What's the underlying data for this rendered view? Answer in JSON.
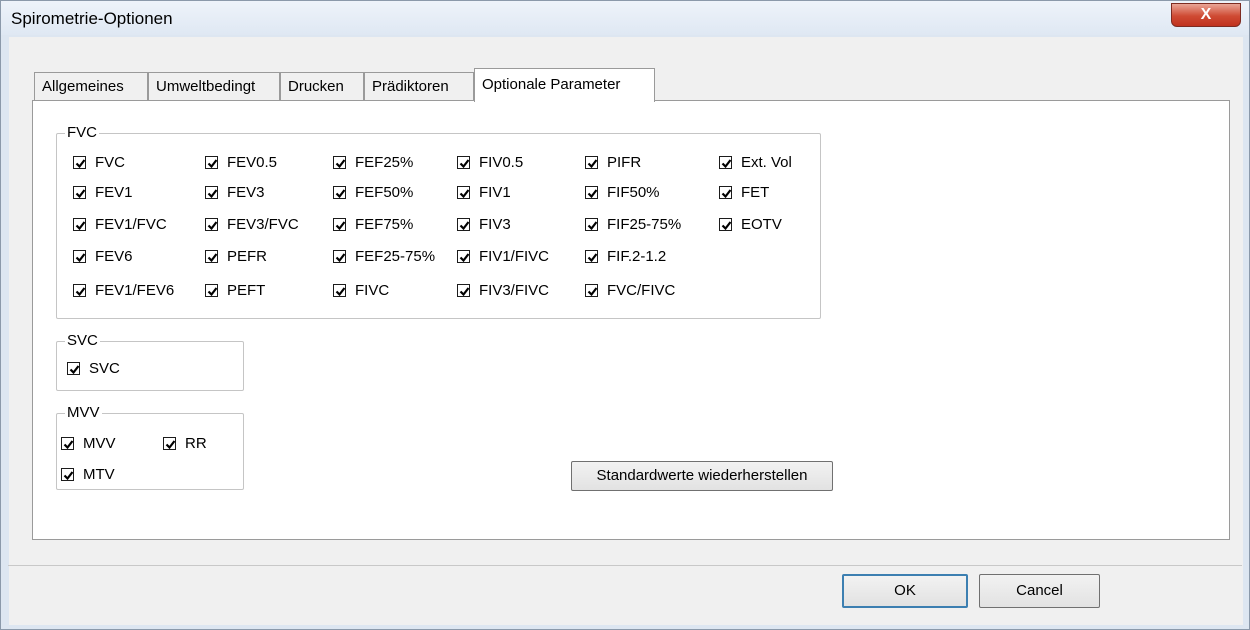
{
  "window": {
    "title": "Spirometrie-Optionen",
    "close_glyph": "X"
  },
  "tabs": [
    {
      "label": "Allgemeines",
      "active": false
    },
    {
      "label": "Umweltbedingt",
      "active": false
    },
    {
      "label": "Drucken",
      "active": false
    },
    {
      "label": "Prädiktoren",
      "active": false
    },
    {
      "label": "Optionale Parameter",
      "active": true
    }
  ],
  "groups": {
    "fvc": {
      "title": "FVC",
      "columns": [
        [
          {
            "label": "FVC",
            "checked": true
          },
          {
            "label": "FEV1",
            "checked": true
          },
          {
            "label": "FEV1/FVC",
            "checked": true
          },
          {
            "label": "FEV6",
            "checked": true
          },
          {
            "label": "FEV1/FEV6",
            "checked": true
          }
        ],
        [
          {
            "label": "FEV0.5",
            "checked": true
          },
          {
            "label": "FEV3",
            "checked": true
          },
          {
            "label": "FEV3/FVC",
            "checked": true
          },
          {
            "label": "PEFR",
            "checked": true
          },
          {
            "label": "PEFT",
            "checked": true
          }
        ],
        [
          {
            "label": "FEF25%",
            "checked": true
          },
          {
            "label": "FEF50%",
            "checked": true
          },
          {
            "label": "FEF75%",
            "checked": true
          },
          {
            "label": "FEF25-75%",
            "checked": true
          },
          {
            "label": "FIVC",
            "checked": true
          }
        ],
        [
          {
            "label": "FIV0.5",
            "checked": true
          },
          {
            "label": "FIV1",
            "checked": true
          },
          {
            "label": "FIV3",
            "checked": true
          },
          {
            "label": "FIV1/FIVC",
            "checked": true
          },
          {
            "label": "FIV3/FIVC",
            "checked": true
          }
        ],
        [
          {
            "label": "PIFR",
            "checked": true
          },
          {
            "label": "FIF50%",
            "checked": true
          },
          {
            "label": "FIF25-75%",
            "checked": true
          },
          {
            "label": "FIF.2-1.2",
            "checked": true
          },
          {
            "label": "FVC/FIVC",
            "checked": true
          }
        ],
        [
          {
            "label": "Ext. Vol",
            "checked": true
          },
          {
            "label": "FET",
            "checked": true
          },
          {
            "label": "EOTV",
            "checked": true
          }
        ]
      ]
    },
    "svc": {
      "title": "SVC",
      "items": [
        {
          "label": "SVC",
          "checked": true
        }
      ]
    },
    "mvv": {
      "title": "MVV",
      "items": [
        {
          "label": "MVV",
          "checked": true
        },
        {
          "label": "RR",
          "checked": true
        },
        {
          "label": "MTV",
          "checked": true
        }
      ]
    }
  },
  "restore_defaults_label": "Standardwerte wiederherstellen",
  "footer": {
    "ok_label": "OK",
    "cancel_label": "Cancel"
  }
}
